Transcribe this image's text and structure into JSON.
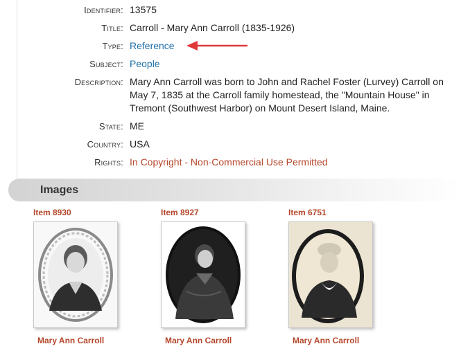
{
  "metadata": {
    "identifier": {
      "label": "Identifier:",
      "value": "13575"
    },
    "title": {
      "label": "Title:",
      "value": "Carroll - Mary Ann Carroll (1835-1926)"
    },
    "type": {
      "label": "Type:",
      "value": "Reference"
    },
    "subject": {
      "label": "Subject:",
      "value": "People"
    },
    "description": {
      "label": "Description:",
      "value": "Mary Ann Carroll was born to John and Rachel Foster (Lurvey) Carroll on May 7, 1835 at the Carroll family homestead, the \"Mountain House\" in Tremont (Southwest Harbor) on Mount Desert Island, Maine."
    },
    "state": {
      "label": "State:",
      "value": "ME"
    },
    "country": {
      "label": "Country:",
      "value": "USA"
    },
    "rights": {
      "label": "Rights:",
      "value": "In Copyright - Non-Commercial Use Permitted"
    }
  },
  "images_section": {
    "title": "Images",
    "items": [
      {
        "label": "Item 8930",
        "caption": "Mary Ann Carroll"
      },
      {
        "label": "Item 8927",
        "caption": "Mary Ann Carroll"
      },
      {
        "label": "Item 6751",
        "caption": "Mary Ann Carroll"
      }
    ]
  },
  "colors": {
    "link": "#1f6fa8",
    "accent": "#b5462a",
    "arrow": "#e0393b"
  }
}
